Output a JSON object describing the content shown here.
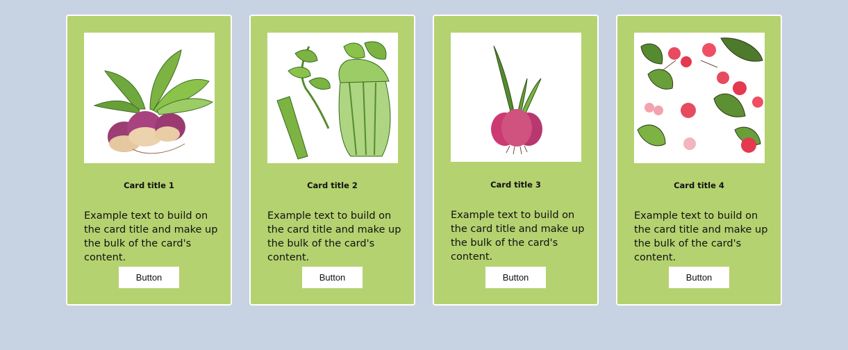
{
  "cards": [
    {
      "title": "Card title 1",
      "text": "Example text to build on the card title and make up the bulk of the card's content.",
      "button_label": "Button"
    },
    {
      "title": "Card title 2",
      "text": "Example text to build on the card title and make up the bulk of the card's content.",
      "button_label": "Button"
    },
    {
      "title": "Card title 3",
      "text": "Example text to build on the card title and make up the bulk of the card's content.",
      "button_label": "Button"
    },
    {
      "title": "Card title 4",
      "text": "Example text to build on the card title and make up the bulk of the card's content.",
      "button_label": "Button"
    }
  ]
}
